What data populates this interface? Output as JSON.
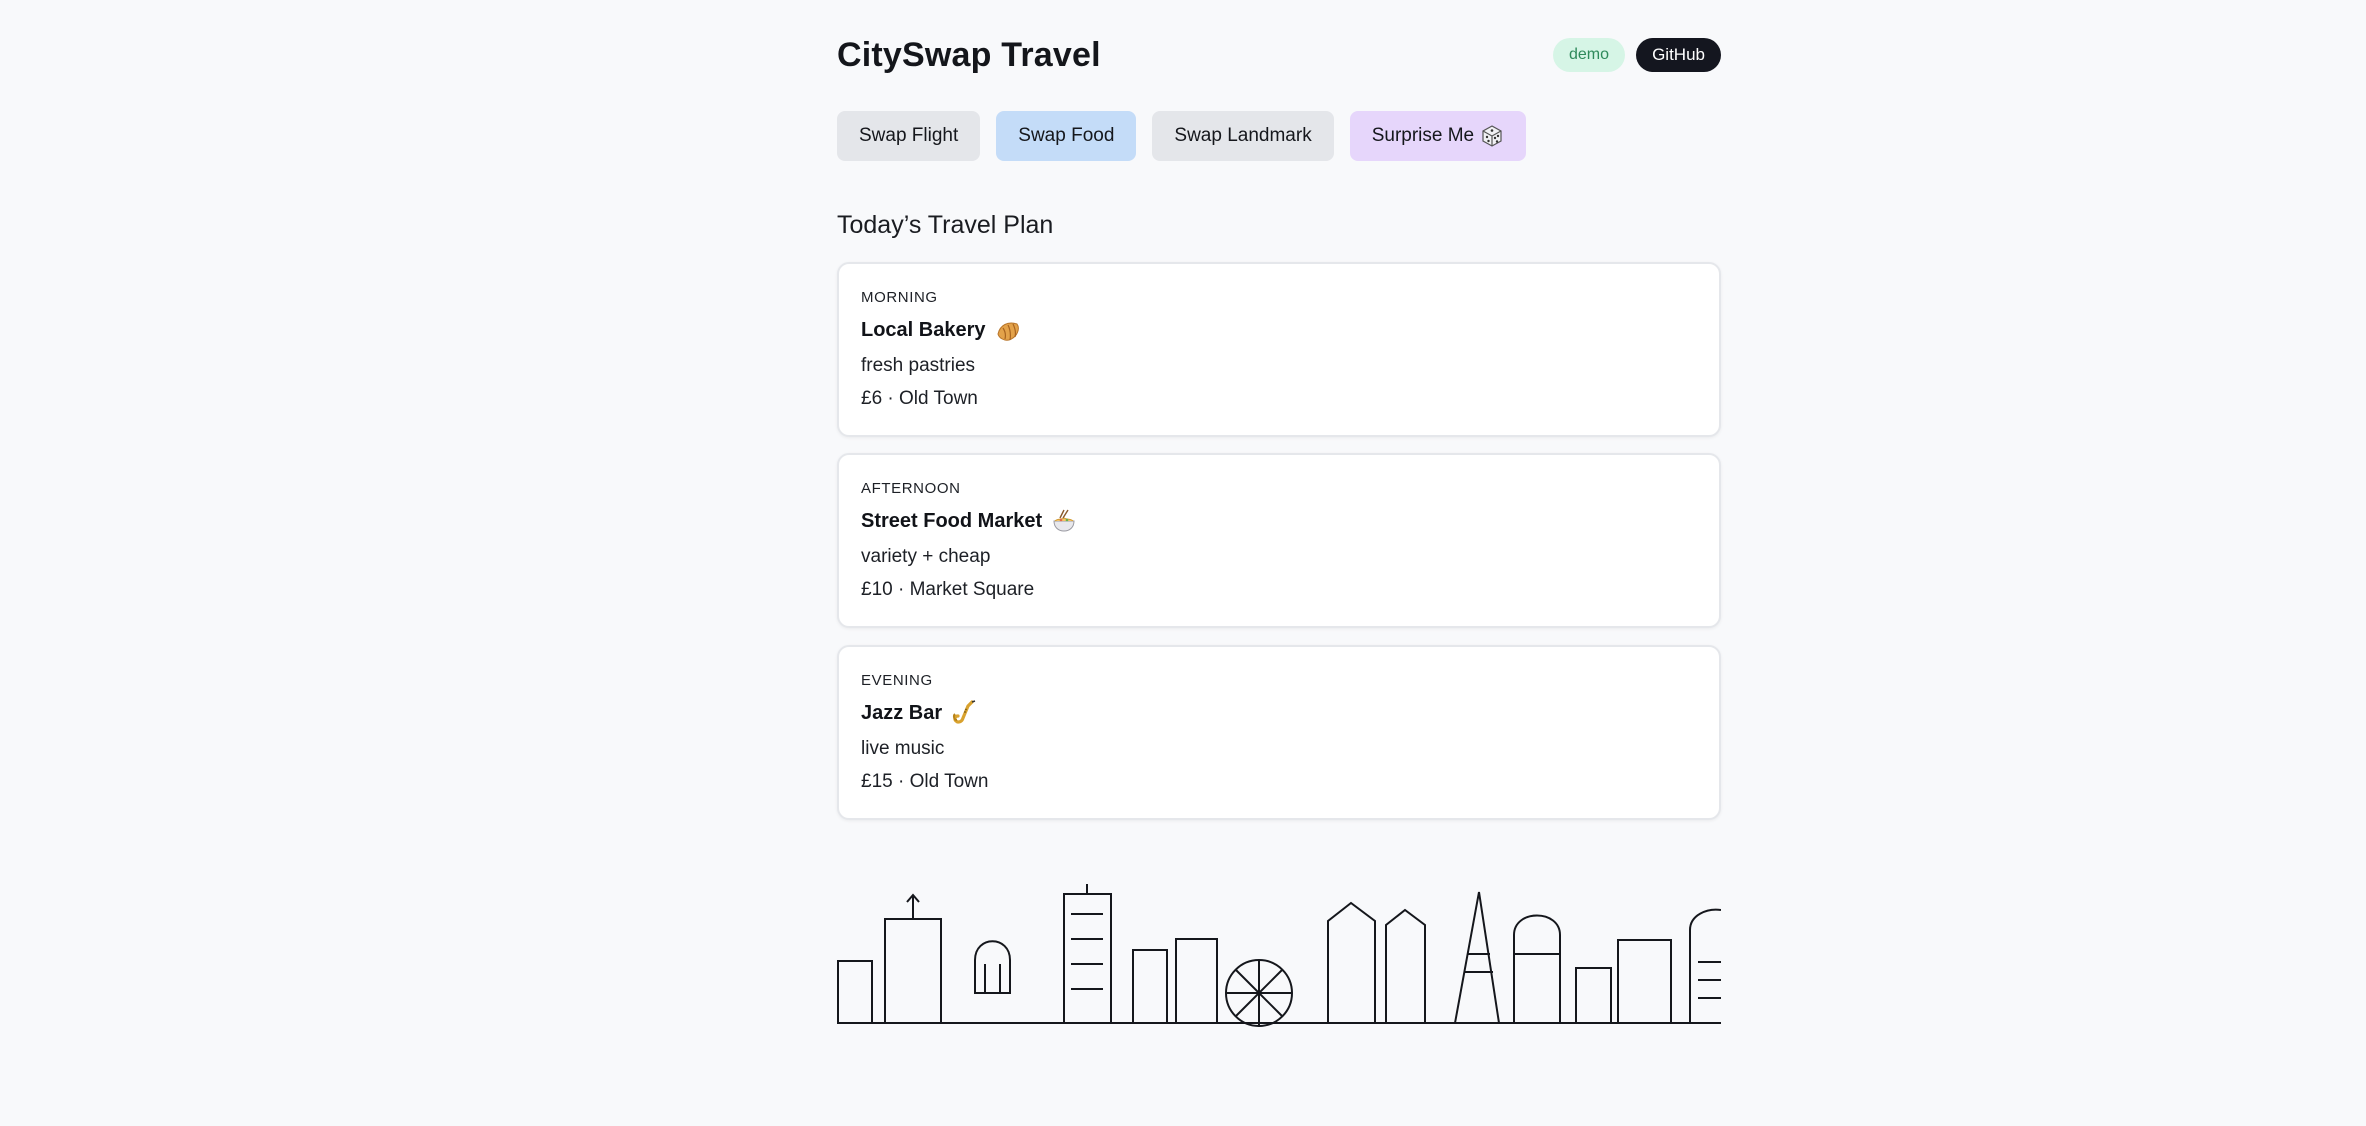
{
  "header": {
    "title": "CitySwap Travel",
    "demo_badge": "demo",
    "github_button": "GitHub"
  },
  "actions": {
    "swap_flight": "Swap Flight",
    "swap_food": "Swap Food",
    "swap_landmark": "Swap Landmark",
    "surprise_me": "Surprise Me"
  },
  "plan": {
    "title": "Today’s Travel Plan",
    "items": [
      {
        "time": "MORNING",
        "name": "Local Bakery",
        "icon": "croissant-icon",
        "desc": "fresh pastries",
        "meta": "£6 · Old Town"
      },
      {
        "time": "AFTERNOON",
        "name": "Street Food Market",
        "icon": "noodle-bowl-icon",
        "desc": "variety + cheap",
        "meta": "£10 · Market Square"
      },
      {
        "time": "EVENING",
        "name": "Jazz Bar",
        "icon": "saxophone-icon",
        "desc": "live music",
        "meta": "£15 · Old Town"
      }
    ]
  },
  "colors": {
    "background": "#f8f9fb",
    "swap_food_active": "#c4dcf8",
    "surprise_me": "#e6d6fb",
    "demo_badge_bg": "#d6f5e6",
    "github_bg": "#14161f"
  }
}
